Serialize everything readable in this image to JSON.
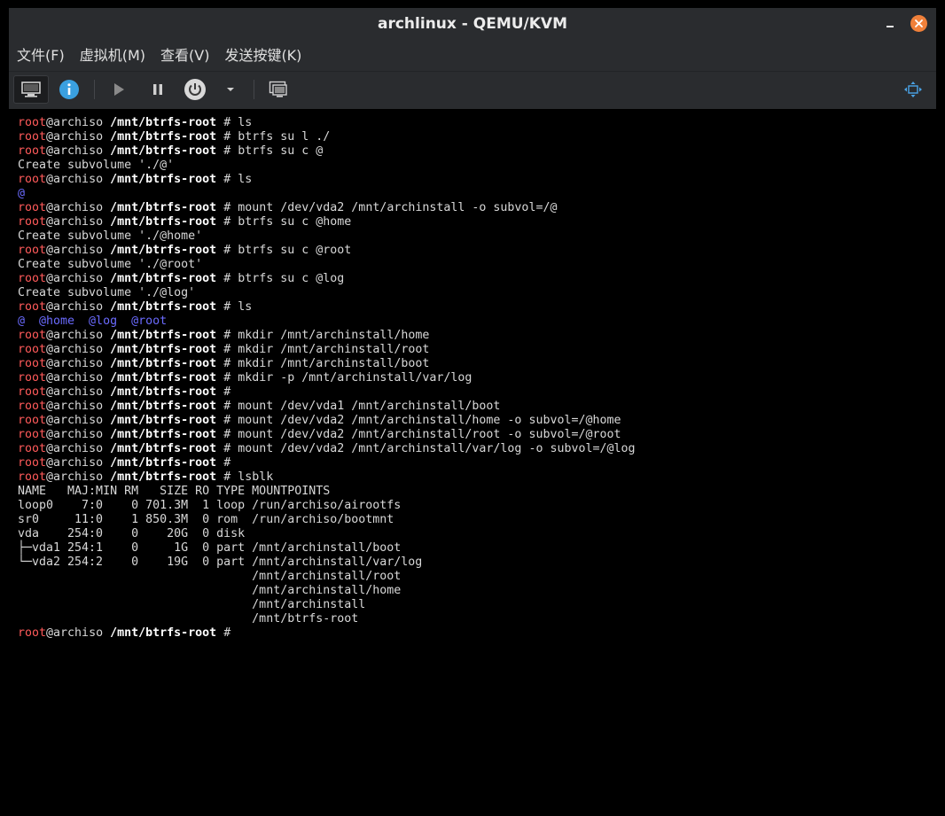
{
  "window": {
    "title": "archlinux - QEMU/KVM",
    "minimize_icon": "minimize-icon",
    "close_icon": "close-icon",
    "close_color": "#f0803a"
  },
  "menubar": {
    "items": [
      "文件(F)",
      "虚拟机(M)",
      "查看(V)",
      "发送按键(K)"
    ]
  },
  "toolbar": {
    "icons": [
      "monitor-icon",
      "info-icon",
      "play-icon",
      "pause-icon",
      "power-icon",
      "chevron-down-icon",
      "screenshot-icon",
      "fullscreen-icon"
    ],
    "info_color": "#3aa0e0"
  },
  "terminal": {
    "prompt_user": "root",
    "prompt_host": "@archiso",
    "prompt_path": "/mnt/btrfs-root",
    "user_color": "#ff5a5a",
    "dir_color": "#6b6bff",
    "lines": [
      {
        "type": "prompt",
        "cmd": "ls"
      },
      {
        "type": "prompt",
        "cmd": "btrfs su l ./"
      },
      {
        "type": "prompt",
        "cmd": "btrfs su c @"
      },
      {
        "type": "out",
        "text": "Create subvolume './@'"
      },
      {
        "type": "prompt",
        "cmd": "ls"
      },
      {
        "type": "dirs",
        "text": "@"
      },
      {
        "type": "prompt",
        "cmd": "mount /dev/vda2 /mnt/archinstall -o subvol=/@"
      },
      {
        "type": "prompt",
        "cmd": "btrfs su c @home"
      },
      {
        "type": "out",
        "text": "Create subvolume './@home'"
      },
      {
        "type": "prompt",
        "cmd": "btrfs su c @root"
      },
      {
        "type": "out",
        "text": "Create subvolume './@root'"
      },
      {
        "type": "prompt",
        "cmd": "btrfs su c @log"
      },
      {
        "type": "out",
        "text": "Create subvolume './@log'"
      },
      {
        "type": "prompt",
        "cmd": "ls"
      },
      {
        "type": "dirs",
        "text": "@  @home  @log  @root"
      },
      {
        "type": "prompt",
        "cmd": "mkdir /mnt/archinstall/home"
      },
      {
        "type": "prompt",
        "cmd": "mkdir /mnt/archinstall/root"
      },
      {
        "type": "prompt",
        "cmd": "mkdir /mnt/archinstall/boot"
      },
      {
        "type": "prompt",
        "cmd": "mkdir -p /mnt/archinstall/var/log"
      },
      {
        "type": "prompt",
        "cmd": ""
      },
      {
        "type": "prompt",
        "cmd": "mount /dev/vda1 /mnt/archinstall/boot"
      },
      {
        "type": "prompt",
        "cmd": "mount /dev/vda2 /mnt/archinstall/home -o subvol=/@home"
      },
      {
        "type": "prompt",
        "cmd": "mount /dev/vda2 /mnt/archinstall/root -o subvol=/@root"
      },
      {
        "type": "prompt",
        "cmd": "mount /dev/vda2 /mnt/archinstall/var/log -o subvol=/@log"
      },
      {
        "type": "prompt",
        "cmd": ""
      },
      {
        "type": "prompt",
        "cmd": "lsblk"
      },
      {
        "type": "out",
        "text": "NAME   MAJ:MIN RM   SIZE RO TYPE MOUNTPOINTS"
      },
      {
        "type": "out",
        "text": "loop0    7:0    0 701.3M  1 loop /run/archiso/airootfs"
      },
      {
        "type": "out",
        "text": "sr0     11:0    1 850.3M  0 rom  /run/archiso/bootmnt"
      },
      {
        "type": "out",
        "text": "vda    254:0    0    20G  0 disk"
      },
      {
        "type": "out",
        "text": "├─vda1 254:1    0     1G  0 part /mnt/archinstall/boot"
      },
      {
        "type": "out",
        "text": "└─vda2 254:2    0    19G  0 part /mnt/archinstall/var/log"
      },
      {
        "type": "out",
        "text": "                                 /mnt/archinstall/root"
      },
      {
        "type": "out",
        "text": "                                 /mnt/archinstall/home"
      },
      {
        "type": "out",
        "text": "                                 /mnt/archinstall"
      },
      {
        "type": "out",
        "text": "                                 /mnt/btrfs-root"
      },
      {
        "type": "prompt",
        "cmd": ""
      }
    ]
  }
}
